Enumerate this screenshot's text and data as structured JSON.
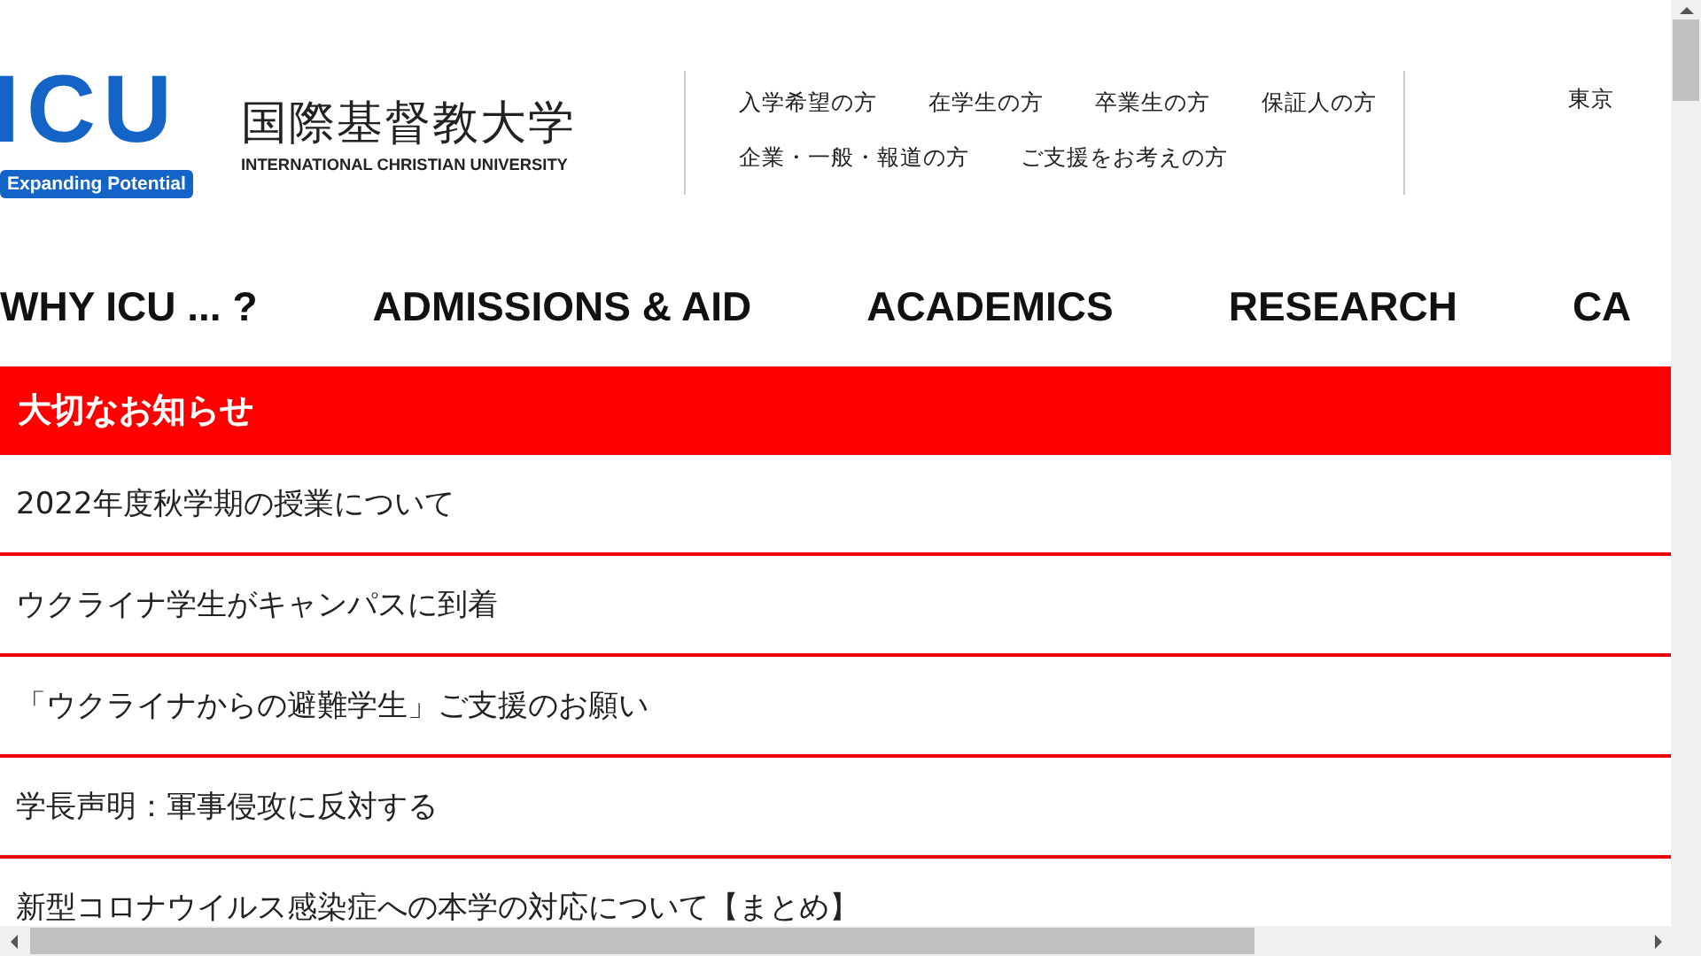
{
  "logo": {
    "mark": "ICU",
    "tagline": "Expanding Potential",
    "name_ja": "国際基督教大学",
    "name_en": "INTERNATIONAL CHRISTIAN UNIVERSITY"
  },
  "audience_links": [
    [
      "入学希望の方",
      "在学生の方",
      "卒業生の方",
      "保証人の方"
    ],
    [
      "企業・一般・報道の方",
      "ご支援をお考えの方"
    ]
  ],
  "language_link": "東京",
  "main_nav": [
    "WHY ICU ... ?",
    "ADMISSIONS & AID",
    "ACADEMICS",
    "RESEARCH",
    "CA"
  ],
  "notices": {
    "title": "大切なお知らせ",
    "items": [
      "2022年度秋学期の授業について",
      "ウクライナ学生がキャンパスに到着",
      "「ウクライナからの避難学生」ご支援のお願い",
      "学長声明：軍事侵攻に反対する",
      "新型コロナウイルス感染症への本学の対応について【まとめ】"
    ]
  }
}
